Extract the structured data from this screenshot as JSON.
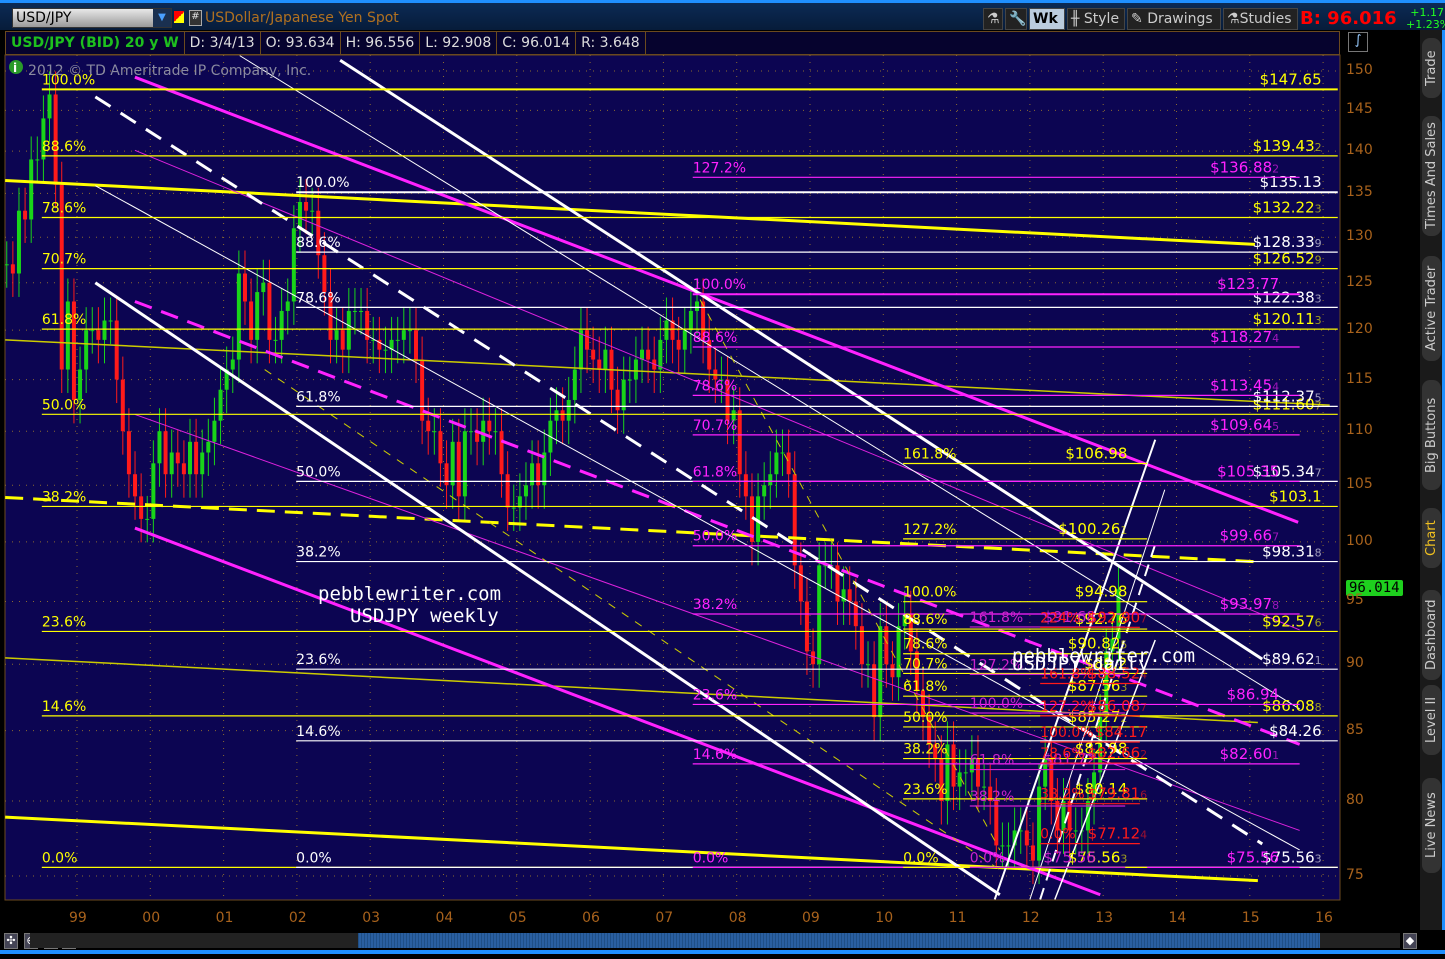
{
  "toolbar": {
    "symbol": "USD/JPY",
    "description": "USDollar/Japanese Yen Spot",
    "wk": "Wk",
    "style": "Style",
    "drawings": "Drawings",
    "studies": "Studies",
    "bid": "B: 96.016",
    "change": "+1.17",
    "change_pct": "+1.23%"
  },
  "info": {
    "title": "USD/JPY (BID) 20 y W",
    "date": "D: 3/4/13",
    "open": "O: 93.634",
    "high": "H: 96.556",
    "low": "L: 92.908",
    "close": "C: 96.014",
    "range": "R: 3.648"
  },
  "copyright": "2012 © TD Ameritrade IP Company, Inc.",
  "current_price": "96.014",
  "tabs": [
    "Trade",
    "Times And Sales",
    "Active Trader",
    "Big Buttons",
    "Chart",
    "Dashboard",
    "Level II",
    "Live News"
  ],
  "watermarks": [
    {
      "line1": "pebblewriter.com",
      "line2": "USDJPY weekly"
    },
    {
      "line1": "pebblewriter.com",
      "line2": "USDJPY daily"
    }
  ],
  "colors": {
    "background": "#0c0552",
    "up": "#19d419",
    "down": "#ff1a1a",
    "yellow": "#ffff00",
    "white": "#ffffff",
    "magenta": "#ff22ff",
    "red": "#ff1a1a"
  },
  "chart_data": {
    "type": "candlestick",
    "title": "USD/JPY (BID) 20 y W",
    "scale": "log",
    "ylim": [
      74,
      152
    ],
    "xlim": [
      1998.0,
      2016.2
    ],
    "yticks": [
      150,
      145,
      140,
      135,
      130,
      125,
      120,
      115,
      110,
      105,
      100,
      95,
      90,
      85,
      80,
      75
    ],
    "xticks": [
      "99",
      "00",
      "01",
      "02",
      "03",
      "04",
      "05",
      "06",
      "07",
      "08",
      "09",
      "10",
      "11",
      "12",
      "13",
      "14",
      "15",
      "16"
    ],
    "start": 1998.0,
    "period": "monthly approximation",
    "closes": [
      127,
      126,
      133,
      132,
      139,
      139,
      144,
      147,
      136,
      116,
      123,
      113,
      116,
      120,
      120,
      119,
      121,
      121,
      115,
      110,
      106,
      104,
      102,
      102,
      107,
      110,
      106,
      108,
      107,
      106,
      109,
      106,
      108,
      109,
      111,
      114,
      116,
      117,
      126,
      123,
      119,
      124,
      125,
      119,
      119,
      122,
      123,
      131,
      134,
      133,
      133,
      128,
      124,
      119,
      120,
      118,
      122,
      122,
      122,
      119,
      119,
      118,
      118,
      119,
      119,
      120,
      120,
      117,
      111,
      110,
      110,
      107,
      105,
      109,
      104,
      110,
      110,
      109,
      111,
      110,
      110,
      106,
      103,
      103,
      104,
      105,
      107,
      105,
      108,
      111,
      112,
      111,
      113,
      116,
      120,
      118,
      117,
      116,
      118,
      114,
      112,
      115,
      115,
      117,
      118,
      117,
      116,
      119,
      121,
      119,
      118,
      120,
      122,
      123,
      119,
      116,
      115,
      115,
      111,
      112,
      106,
      104,
      100,
      104,
      105,
      106,
      108,
      108,
      106,
      98,
      95,
      91,
      90,
      98,
      98,
      98,
      95,
      96,
      95,
      93,
      90,
      90,
      86,
      93,
      90,
      89,
      93,
      94,
      91,
      88,
      86,
      84,
      83,
      80,
      84,
      81,
      82,
      82,
      83,
      81,
      81,
      80,
      77,
      77,
      77,
      78,
      78,
      77,
      76,
      81,
      83,
      80,
      78,
      80,
      78,
      78,
      78,
      80,
      82,
      86,
      91,
      92,
      96
    ],
    "fib_sets": [
      {
        "color": "#ffff00",
        "start": 1998.52,
        "end": 2016.2,
        "price_at": 2015.98,
        "levels": [
          {
            "pct": "100.0%",
            "price": 147.65,
            "label": "$147.65",
            "suffix": ""
          },
          {
            "pct": "88.6%",
            "price": 139.43,
            "label": "$139.43",
            "suffix": "2"
          },
          {
            "pct": "78.6%",
            "price": 132.22,
            "label": "$132.22",
            "suffix": "3"
          },
          {
            "pct": "70.7%",
            "price": 126.53,
            "label": "$126.52",
            "suffix": "9"
          },
          {
            "pct": "61.8%",
            "price": 120.11,
            "label": "$120.11",
            "suffix": "3"
          },
          {
            "pct": "50.0%",
            "price": 111.61,
            "label": "$111.60",
            "suffix": "7"
          },
          {
            "pct": "38.2%",
            "price": 103.1,
            "label": "$103.1",
            "suffix": ""
          },
          {
            "pct": "23.6%",
            "price": 92.58,
            "label": "$92.57",
            "suffix": "6"
          },
          {
            "pct": "14.6%",
            "price": 86.09,
            "label": "$86.08",
            "suffix": "8"
          },
          {
            "pct": "0.0%",
            "price": 75.56,
            "label": "",
            "suffix": ""
          }
        ]
      },
      {
        "color": "#ffffff",
        "start": 2001.99,
        "end": 2016.2,
        "price_at": 2015.98,
        "levels": [
          {
            "pct": "100.0%",
            "price": 135.13,
            "label": "$135.13",
            "suffix": ""
          },
          {
            "pct": "88.6%",
            "price": 128.34,
            "label": "$128.33",
            "suffix": "9"
          },
          {
            "pct": "78.6%",
            "price": 122.38,
            "label": "$122.38",
            "suffix": "3"
          },
          {
            "pct": "61.8%",
            "price": 112.38,
            "label": "$112.37",
            "suffix": "5"
          },
          {
            "pct": "50.0%",
            "price": 105.35,
            "label": "$105.34",
            "suffix": "7"
          },
          {
            "pct": "38.2%",
            "price": 98.32,
            "label": "$98.31",
            "suffix": "8"
          },
          {
            "pct": "23.6%",
            "price": 89.62,
            "label": "$89.62",
            "suffix": "1"
          },
          {
            "pct": "14.6%",
            "price": 84.26,
            "label": "$84.26",
            "suffix": ""
          },
          {
            "pct": "0.0%",
            "price": 75.56,
            "label": "$75.56",
            "suffix": "3"
          }
        ]
      },
      {
        "color": "#ff22ff",
        "start": 2007.4,
        "end": 2015.68,
        "price_at": 2015.4,
        "levels": [
          {
            "pct": "127.2%",
            "price": 136.88,
            "label": "$136.88",
            "suffix": "2"
          },
          {
            "pct": "100.0%",
            "price": 123.77,
            "label": "$123.77",
            "suffix": ""
          },
          {
            "pct": "88.6%",
            "price": 118.27,
            "label": "$118.27",
            "suffix": "4"
          },
          {
            "pct": "78.6%",
            "price": 113.45,
            "label": "$113.45",
            "suffix": "4"
          },
          {
            "pct": "70.7%",
            "price": 109.65,
            "label": "$109.64",
            "suffix": "5"
          },
          {
            "pct": "61.8%",
            "price": 105.35,
            "label": "$105.35",
            "suffix": ""
          },
          {
            "pct": "50.0%",
            "price": 99.67,
            "label": "$99.66",
            "suffix": "7"
          },
          {
            "pct": "38.2%",
            "price": 93.98,
            "label": "$93.97",
            "suffix": "8"
          },
          {
            "pct": "23.6%",
            "price": 86.94,
            "label": "$86.94",
            "suffix": ""
          },
          {
            "pct": "14.6%",
            "price": 82.6,
            "label": "$82.60",
            "suffix": "1"
          },
          {
            "pct": "0.0%",
            "price": 75.56,
            "label": "$75.56",
            "suffix": ""
          }
        ]
      },
      {
        "color": "#ffff00",
        "start": 2010.27,
        "end": 2013.6,
        "price_at": 2013.33,
        "levels": [
          {
            "pct": "161.8%",
            "price": 106.98,
            "label": "$106.98",
            "suffix": ""
          },
          {
            "pct": "127.2%",
            "price": 100.26,
            "label": "$100.26",
            "suffix": "1"
          },
          {
            "pct": "100.0%",
            "price": 94.98,
            "label": "$94.98",
            "suffix": ""
          },
          {
            "pct": "88.6%",
            "price": 92.77,
            "label": "$92.76",
            "suffix": ""
          },
          {
            "pct": "78.6%",
            "price": 90.82,
            "label": "$90.82",
            "suffix": "5"
          },
          {
            "pct": "70.7%",
            "price": 89.29,
            "label": "$89.2",
            "suffix": ""
          },
          {
            "pct": "61.8%",
            "price": 87.56,
            "label": "$87.56",
            "suffix": "3"
          },
          {
            "pct": "50.0%",
            "price": 85.27,
            "label": "$85.27",
            "suffix": "2"
          },
          {
            "pct": "38.2%",
            "price": 82.98,
            "label": "$82.98",
            "suffix": ""
          },
          {
            "pct": "23.6%",
            "price": 80.15,
            "label": "$80.14",
            "suffix": ""
          },
          {
            "pct": "0.0%",
            "price": 75.56,
            "label": "$75.56",
            "suffix": "3"
          }
        ]
      },
      {
        "color": "#cc22cc",
        "start": 2011.18,
        "end": 2013.3,
        "price_at": 2012.9,
        "levels": [
          {
            "pct": "161.8%",
            "price": 92.94,
            "label": "$91.68",
            "suffix": ""
          },
          {
            "pct": "127.2%",
            "price": 89.22,
            "label": "",
            "suffix": ""
          },
          {
            "pct": "100.0%",
            "price": 86.3,
            "label": "",
            "suffix": ""
          },
          {
            "pct": "61.8%",
            "price": 82.2,
            "label": "$81.72",
            "suffix": ""
          },
          {
            "pct": "38.2%",
            "price": 79.66,
            "label": "",
            "suffix": ""
          },
          {
            "pct": "0.0%",
            "price": 75.56,
            "label": "$75.56",
            "suffix": ""
          }
        ]
      },
      {
        "color": "#ff1a1a",
        "start": 2012.14,
        "end": 2013.5,
        "price_at": 2013.6,
        "levels": [
          {
            "pct": "224%",
            "price": 92.91,
            "label": "$92.90",
            "suffix": "7"
          },
          {
            "pct": "161.8%",
            "price": 88.52,
            "label": "$88.52",
            "suffix": "4"
          },
          {
            "pct": "127.2%",
            "price": 86.09,
            "label": "$86.08",
            "suffix": "7"
          },
          {
            "pct": "100.0%",
            "price": 84.17,
            "label": "$84.17",
            "suffix": ""
          },
          {
            "pct": "78.6%",
            "price": 82.66,
            "label": "$82.66",
            "suffix": "2"
          },
          {
            "pct": "38.2%",
            "price": 79.82,
            "label": "$79.81",
            "suffix": "6"
          },
          {
            "pct": "0.0%",
            "price": 77.12,
            "label": "$77.12",
            "suffix": "4"
          }
        ]
      }
    ],
    "trendlines": [
      {
        "color": "#ffff00",
        "w": 3,
        "dash": "",
        "p": [
          [
            1998.02,
            136.5
          ],
          [
            2015.07,
            129.2
          ]
        ]
      },
      {
        "color": "#cccc00",
        "w": 1.5,
        "dash": "",
        "p": [
          [
            1998.02,
            119.0
          ],
          [
            2016.09,
            112.5
          ]
        ]
      },
      {
        "color": "#ffff00",
        "w": 3,
        "dash": "18,10",
        "p": [
          [
            1998.02,
            103.9
          ],
          [
            2015.11,
            98.3
          ]
        ]
      },
      {
        "color": "#cccc00",
        "w": 1.5,
        "dash": "",
        "p": [
          [
            1998.02,
            90.5
          ],
          [
            2015.11,
            85.6
          ]
        ]
      },
      {
        "color": "#ffff00",
        "w": 3,
        "dash": "",
        "p": [
          [
            1998.02,
            78.9
          ],
          [
            2015.11,
            74.7
          ]
        ]
      },
      {
        "color": "#ff22ff",
        "w": 3,
        "dash": "",
        "p": [
          [
            1999.79,
            149.2
          ],
          [
            2015.66,
            101.7
          ]
        ]
      },
      {
        "color": "#ff22ff",
        "w": 3,
        "dash": "",
        "p": [
          [
            1999.79,
            101.2
          ],
          [
            2012.96,
            73.8
          ]
        ]
      },
      {
        "color": "#ff22ff",
        "w": 3,
        "dash": "18,10",
        "p": [
          [
            1999.79,
            123.0
          ],
          [
            2015.68,
            84.0
          ]
        ]
      },
      {
        "color": "#dd22dd",
        "w": 1,
        "dash": "",
        "p": [
          [
            1999.79,
            140.1
          ],
          [
            2015.68,
            92.7
          ]
        ]
      },
      {
        "color": "#dd22dd",
        "w": 1,
        "dash": "",
        "p": [
          [
            1999.79,
            111.6
          ],
          [
            2015.68,
            78.0
          ]
        ]
      },
      {
        "color": "#ffffff",
        "w": 3,
        "dash": "18,12",
        "p": [
          [
            1999.25,
            146.7
          ],
          [
            2015.17,
            77.1
          ]
        ]
      },
      {
        "color": "#ffffff",
        "w": 3,
        "dash": "",
        "p": [
          [
            1999.25,
            125.0
          ],
          [
            2011.59,
            73.8
          ]
        ]
      },
      {
        "color": "#ffffff",
        "w": 3,
        "dash": "",
        "p": [
          [
            2002.59,
            151.4
          ],
          [
            2015.17,
            90.4
          ]
        ]
      },
      {
        "color": "#ffffff",
        "w": 1,
        "dash": "",
        "p": [
          [
            1999.25,
            135.9
          ],
          [
            2015.68,
            76.7
          ]
        ]
      },
      {
        "color": "#ffffff",
        "w": 1,
        "dash": "",
        "p": [
          [
            2001.22,
            152.0
          ],
          [
            2015.68,
            86.6
          ]
        ]
      },
      {
        "color": "#cccc00",
        "w": 1,
        "dash": "8,8",
        "p": [
          [
            2001.56,
            116.0
          ],
          [
            2011.59,
            75.4
          ]
        ]
      },
      {
        "color": "#cccc00",
        "w": 1,
        "dash": "8,8",
        "p": [
          [
            2007.5,
            123.2
          ],
          [
            2011.59,
            76.7
          ]
        ]
      },
      {
        "color": "#ffffff",
        "w": 2,
        "dash": "",
        "p": [
          [
            2011.52,
            73.5
          ],
          [
            2013.71,
            109.2
          ]
        ]
      },
      {
        "color": "#ffffff",
        "w": 1,
        "dash": "",
        "p": [
          [
            2012.0,
            73.5
          ],
          [
            2013.84,
            104.6
          ]
        ]
      },
      {
        "color": "#ffffff",
        "w": 2,
        "dash": "12,8",
        "p": [
          [
            2012.14,
            73.5
          ],
          [
            2013.71,
            99.8
          ]
        ]
      },
      {
        "color": "#ffffff",
        "w": 1.5,
        "dash": "",
        "p": [
          [
            2012.34,
            73.5
          ],
          [
            2013.71,
            91.9
          ]
        ]
      }
    ]
  }
}
